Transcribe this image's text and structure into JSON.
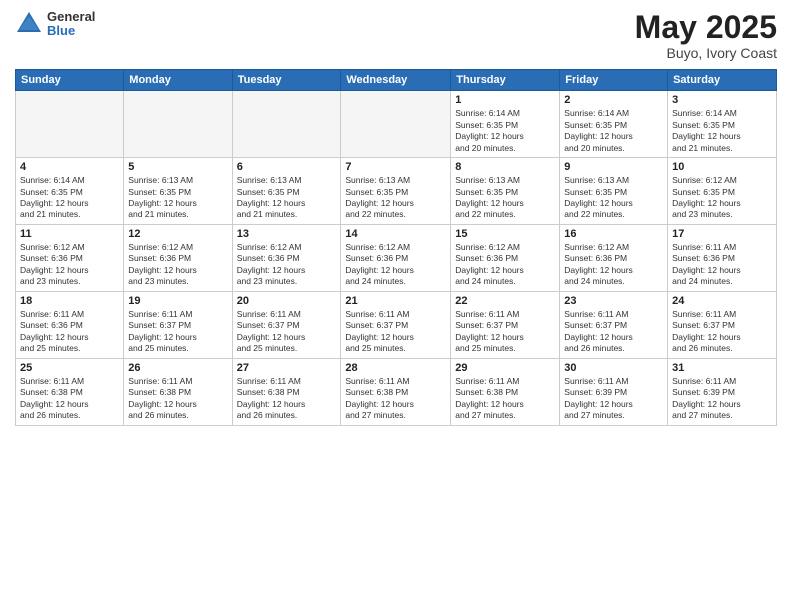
{
  "logo": {
    "general": "General",
    "blue": "Blue"
  },
  "title": "May 2025",
  "subtitle": "Buyo, Ivory Coast",
  "days_of_week": [
    "Sunday",
    "Monday",
    "Tuesday",
    "Wednesday",
    "Thursday",
    "Friday",
    "Saturday"
  ],
  "weeks": [
    [
      {
        "day": "",
        "info": ""
      },
      {
        "day": "",
        "info": ""
      },
      {
        "day": "",
        "info": ""
      },
      {
        "day": "",
        "info": ""
      },
      {
        "day": "1",
        "info": "Sunrise: 6:14 AM\nSunset: 6:35 PM\nDaylight: 12 hours\nand 20 minutes."
      },
      {
        "day": "2",
        "info": "Sunrise: 6:14 AM\nSunset: 6:35 PM\nDaylight: 12 hours\nand 20 minutes."
      },
      {
        "day": "3",
        "info": "Sunrise: 6:14 AM\nSunset: 6:35 PM\nDaylight: 12 hours\nand 21 minutes."
      }
    ],
    [
      {
        "day": "4",
        "info": "Sunrise: 6:14 AM\nSunset: 6:35 PM\nDaylight: 12 hours\nand 21 minutes."
      },
      {
        "day": "5",
        "info": "Sunrise: 6:13 AM\nSunset: 6:35 PM\nDaylight: 12 hours\nand 21 minutes."
      },
      {
        "day": "6",
        "info": "Sunrise: 6:13 AM\nSunset: 6:35 PM\nDaylight: 12 hours\nand 21 minutes."
      },
      {
        "day": "7",
        "info": "Sunrise: 6:13 AM\nSunset: 6:35 PM\nDaylight: 12 hours\nand 22 minutes."
      },
      {
        "day": "8",
        "info": "Sunrise: 6:13 AM\nSunset: 6:35 PM\nDaylight: 12 hours\nand 22 minutes."
      },
      {
        "day": "9",
        "info": "Sunrise: 6:13 AM\nSunset: 6:35 PM\nDaylight: 12 hours\nand 22 minutes."
      },
      {
        "day": "10",
        "info": "Sunrise: 6:12 AM\nSunset: 6:35 PM\nDaylight: 12 hours\nand 23 minutes."
      }
    ],
    [
      {
        "day": "11",
        "info": "Sunrise: 6:12 AM\nSunset: 6:36 PM\nDaylight: 12 hours\nand 23 minutes."
      },
      {
        "day": "12",
        "info": "Sunrise: 6:12 AM\nSunset: 6:36 PM\nDaylight: 12 hours\nand 23 minutes."
      },
      {
        "day": "13",
        "info": "Sunrise: 6:12 AM\nSunset: 6:36 PM\nDaylight: 12 hours\nand 23 minutes."
      },
      {
        "day": "14",
        "info": "Sunrise: 6:12 AM\nSunset: 6:36 PM\nDaylight: 12 hours\nand 24 minutes."
      },
      {
        "day": "15",
        "info": "Sunrise: 6:12 AM\nSunset: 6:36 PM\nDaylight: 12 hours\nand 24 minutes."
      },
      {
        "day": "16",
        "info": "Sunrise: 6:12 AM\nSunset: 6:36 PM\nDaylight: 12 hours\nand 24 minutes."
      },
      {
        "day": "17",
        "info": "Sunrise: 6:11 AM\nSunset: 6:36 PM\nDaylight: 12 hours\nand 24 minutes."
      }
    ],
    [
      {
        "day": "18",
        "info": "Sunrise: 6:11 AM\nSunset: 6:36 PM\nDaylight: 12 hours\nand 25 minutes."
      },
      {
        "day": "19",
        "info": "Sunrise: 6:11 AM\nSunset: 6:37 PM\nDaylight: 12 hours\nand 25 minutes."
      },
      {
        "day": "20",
        "info": "Sunrise: 6:11 AM\nSunset: 6:37 PM\nDaylight: 12 hours\nand 25 minutes."
      },
      {
        "day": "21",
        "info": "Sunrise: 6:11 AM\nSunset: 6:37 PM\nDaylight: 12 hours\nand 25 minutes."
      },
      {
        "day": "22",
        "info": "Sunrise: 6:11 AM\nSunset: 6:37 PM\nDaylight: 12 hours\nand 25 minutes."
      },
      {
        "day": "23",
        "info": "Sunrise: 6:11 AM\nSunset: 6:37 PM\nDaylight: 12 hours\nand 26 minutes."
      },
      {
        "day": "24",
        "info": "Sunrise: 6:11 AM\nSunset: 6:37 PM\nDaylight: 12 hours\nand 26 minutes."
      }
    ],
    [
      {
        "day": "25",
        "info": "Sunrise: 6:11 AM\nSunset: 6:38 PM\nDaylight: 12 hours\nand 26 minutes."
      },
      {
        "day": "26",
        "info": "Sunrise: 6:11 AM\nSunset: 6:38 PM\nDaylight: 12 hours\nand 26 minutes."
      },
      {
        "day": "27",
        "info": "Sunrise: 6:11 AM\nSunset: 6:38 PM\nDaylight: 12 hours\nand 26 minutes."
      },
      {
        "day": "28",
        "info": "Sunrise: 6:11 AM\nSunset: 6:38 PM\nDaylight: 12 hours\nand 27 minutes."
      },
      {
        "day": "29",
        "info": "Sunrise: 6:11 AM\nSunset: 6:38 PM\nDaylight: 12 hours\nand 27 minutes."
      },
      {
        "day": "30",
        "info": "Sunrise: 6:11 AM\nSunset: 6:39 PM\nDaylight: 12 hours\nand 27 minutes."
      },
      {
        "day": "31",
        "info": "Sunrise: 6:11 AM\nSunset: 6:39 PM\nDaylight: 12 hours\nand 27 minutes."
      }
    ]
  ]
}
